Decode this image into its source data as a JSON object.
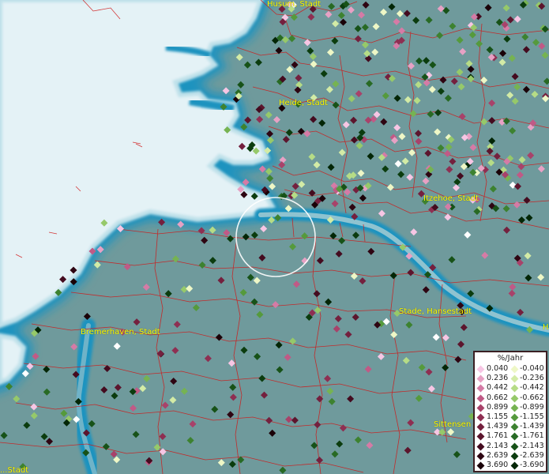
{
  "places": [
    {
      "id": "husum",
      "label": "Husum, Stadt"
    },
    {
      "id": "heide",
      "label": "Heide, Stadt"
    },
    {
      "id": "itzehoe",
      "label": "Itzehoe, Stadt"
    },
    {
      "id": "stade",
      "label": "Stade, Hansestadt"
    },
    {
      "id": "bremerhaven",
      "label": "Bremerhaven, Stadt"
    },
    {
      "id": "sittensen",
      "label": "Sittensen"
    },
    {
      "id": "ha",
      "label": "Ha"
    },
    {
      "id": "bottom-left",
      "label": "...Stadt"
    }
  ],
  "legend": {
    "title": "%/Jahr",
    "positive": [
      {
        "label": "0.040",
        "color": "#f7c6e4"
      },
      {
        "label": "0.236",
        "color": "#e7a1c4"
      },
      {
        "label": "0.442",
        "color": "#d57ba6"
      },
      {
        "label": "0.662",
        "color": "#c05a86"
      },
      {
        "label": "0.899",
        "color": "#a8426a"
      },
      {
        "label": "1.155",
        "color": "#8e2f52"
      },
      {
        "label": "1.439",
        "color": "#74203e"
      },
      {
        "label": "1.761",
        "color": "#5c152d"
      },
      {
        "label": "2.143",
        "color": "#440b1f"
      },
      {
        "label": "2.639",
        "color": "#2e0512"
      },
      {
        "label": "3.690",
        "color": "#1a0208"
      }
    ],
    "negative": [
      {
        "label": "-0.040",
        "color": "#eef7c6"
      },
      {
        "label": "-0.236",
        "color": "#d3eba6"
      },
      {
        "label": "-0.442",
        "color": "#b6dc86"
      },
      {
        "label": "-0.662",
        "color": "#96c96a"
      },
      {
        "label": "-0.899",
        "color": "#76b352"
      },
      {
        "label": "-1.155",
        "color": "#559a3c"
      },
      {
        "label": "-1.439",
        "color": "#3d8230"
      },
      {
        "label": "-1.761",
        "color": "#286a24"
      },
      {
        "label": "-2.143",
        "color": "#175218"
      },
      {
        "label": "-2.639",
        "color": "#0b3c0e"
      },
      {
        "label": "-3.690",
        "color": "#032606"
      }
    ]
  },
  "colors": {
    "sea": "#e4f2f6",
    "land": "#6f9a9c",
    "coast": "#1f93bf",
    "border": "#d01818",
    "label": "#ffff00"
  }
}
